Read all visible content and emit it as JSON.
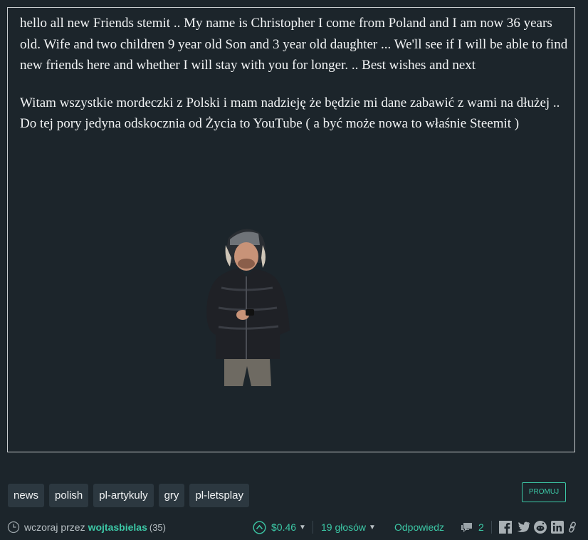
{
  "post": {
    "paragraphs": [
      "hello all new Friends stemit .. My name is Christopher I come from Poland and I am now 36 years old. Wife and two children 9 year old Son and 3 year old daughter ... We'll see if I will be able to find new friends here and whether I will stay with you for longer. .. Best wishes and next",
      "Witam wszystkie mordeczki z Polski i mam nadzieję że będzie mi dane zabawić z wami na dłużej .. Do tej pory jedyna odskocznia od Życia to YouTube ( a być może nowa to właśnie Steemit )"
    ]
  },
  "tags": [
    "news",
    "polish",
    "pl-artykuly",
    "gry",
    "pl-letsplay"
  ],
  "promo_label": "PROMUJ",
  "footer": {
    "time_text": "wczoraj przez",
    "author": "wojtasbielas",
    "reputation": "(35)",
    "payout": "$0.46",
    "votes": "19 głosów",
    "reply": "Odpowiedz",
    "comments": "2"
  },
  "colors": {
    "background": "#1c252b",
    "accent": "#3cc8a6",
    "tag_bg": "#2c3840"
  },
  "icons": [
    "clock-icon",
    "upvote-icon",
    "caret-down-icon",
    "comments-icon",
    "facebook-icon",
    "twitter-icon",
    "reddit-icon",
    "linkedin-icon",
    "link-icon"
  ]
}
